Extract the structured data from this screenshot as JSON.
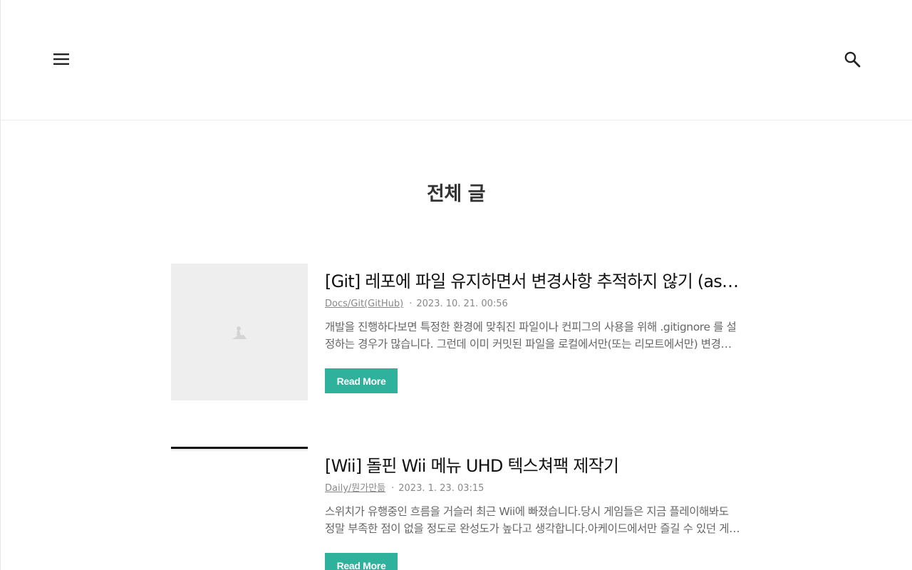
{
  "header": {
    "menu_icon": "hamburger-menu-icon",
    "search_icon": "search-icon"
  },
  "page": {
    "title": "전체 글"
  },
  "posts": [
    {
      "title": "[Git] 레포에 파일 유지하면서 변경사항 추적하지 않기 (assume-unchanged)",
      "category": "Docs/Git(GitHub)",
      "date": "2023. 10. 21. 00:56",
      "excerpt": "개발을 진행하다보면 특정한 환경에 맞춰진 파일이나 컨피그의 사용을 위해 .gitignore 를 설정하는 경우가 많습니다. 그런데 이미 커밋된 파일을 로컬에서만(또는 리모트에서만) 변경사항을 무시하고 싶을 때가 있습니다.",
      "read_more": "Read More",
      "thumbnail_icon": "image-placeholder-icon"
    },
    {
      "title": "[Wii] 돌핀 Wii 메뉴 UHD 텍스쳐팩 제작기",
      "category": "Daily/뭔가만듦",
      "date": "2023. 1. 23. 03:15",
      "excerpt": "스위치가 유행중인 흐름을 거슬러 최근 Wii에 빠졌습니다.당시 게임들은 지금 플레이해봐도 정말 부족한 점이 없을 정도로 완성도가 높다고 생각합니다.아케이드에서만 즐길 수 있던 게임들도",
      "read_more": "Read More"
    }
  ],
  "colors": {
    "accent": "#2fb29c",
    "text": "#111111",
    "muted": "#888888"
  }
}
